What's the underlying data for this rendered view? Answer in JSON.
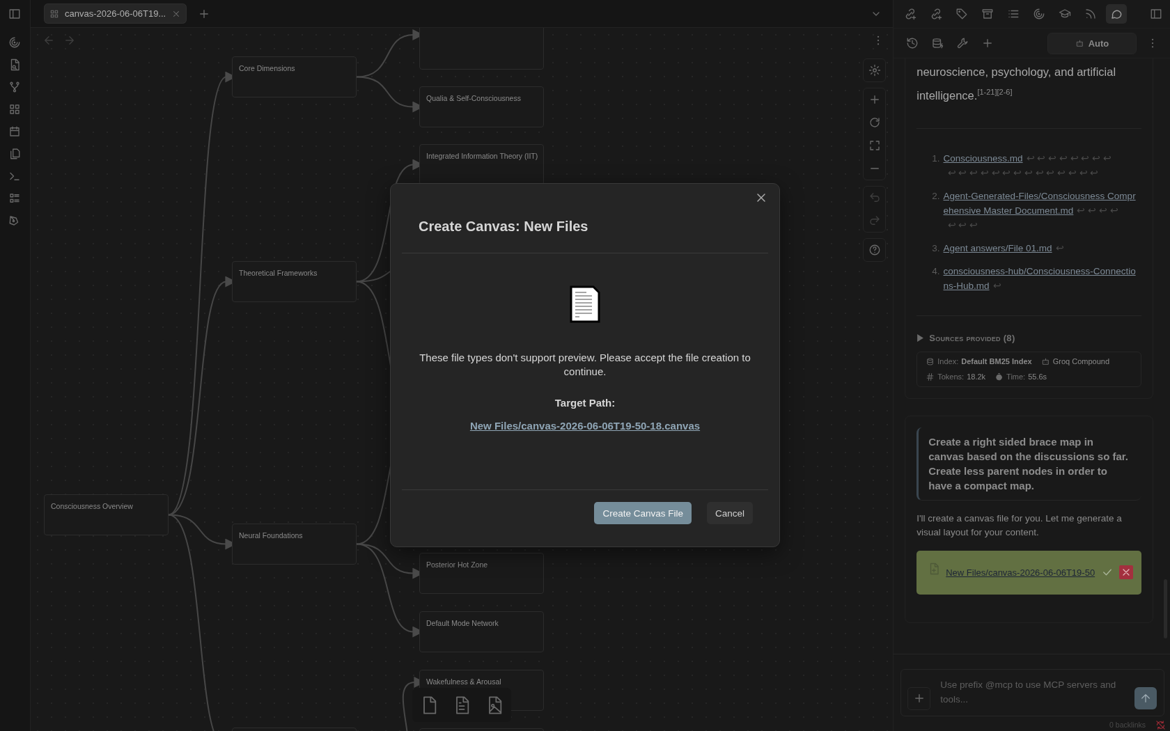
{
  "tab_bar": {
    "tabs": [
      {
        "title": "canvas-2026-06-06T19...",
        "selected": true
      }
    ]
  },
  "canvas": {
    "nodes": [
      {
        "label": "Core Dimensions"
      },
      {
        "label": "Qualia & Self-Consciousness"
      },
      {
        "label": "Integrated Information Theory (IIT)"
      },
      {
        "label": "Theoretical Frameworks"
      },
      {
        "label": "Consciousness Overview"
      },
      {
        "label": "Neural Foundations"
      },
      {
        "label": "Posterior Hot Zone"
      },
      {
        "label": "Default Mode Network"
      },
      {
        "label": "Wakefulness & Arousal"
      }
    ]
  },
  "dialog": {
    "title": "Create Canvas: New Files",
    "message": "These file types don't support preview. Please accept the file creation to continue.",
    "target_label": "Target Path:",
    "target_path": "New Files/canvas-2026-06-06T19-50-18.canvas",
    "buttons": [
      {
        "label": "Create Canvas File",
        "kind": "primary"
      },
      {
        "label": "Cancel",
        "kind": "secondary"
      }
    ]
  },
  "chat": {
    "mode_button": "Auto",
    "answer_tail": "neuroscience, psychology, and artificial intelligence.$^{[1-21][2-6]}$",
    "references": [
      {
        "number": "1.",
        "lines": [
          {
            "link": "Consciousness.md",
            "backrefs": "↩ ↩ ↩ ↩ ↩ ↩ ↩ ↩"
          },
          {
            "backrefs": "↩ ↩ ↩ ↩ ↩ ↩ ↩ ↩ ↩ ↩ ↩ ↩ ↩ ↩"
          }
        ]
      },
      {
        "number": "2.",
        "lines": [
          {
            "link": "Agent-Generated-Files/Consciousness Compr"
          },
          {
            "link": "ehensive Master Document.md",
            "backrefs": "↩ ↩ ↩ ↩"
          },
          {
            "backrefs": "↩ ↩ ↩"
          }
        ]
      },
      {
        "number": "3.",
        "lines": [
          {
            "link": "Agent answers/File 01.md",
            "backrefs": "↩"
          }
        ]
      },
      {
        "number": "4.",
        "lines": [
          {
            "link": "consciousness-hub/Consciousness-Connectio"
          },
          {
            "link": "ns-Hub.md",
            "backrefs": "↩"
          }
        ]
      }
    ],
    "sources": {
      "label": "Sources provided (8)",
      "expanded": false
    },
    "meta": {
      "index_label": "Index:",
      "index_value": "Default BM25 Index",
      "model": "Groq Compound",
      "tokens_label": "Tokens:",
      "tokens_value": "18.2k",
      "time_label": "Time:",
      "time_value": "55.6s"
    },
    "user_message": "Create a right sided brace map in canvas based on the discussions so far. Create less parent nodes in order to have a compact map.",
    "reply": "I'll create a canvas file for you. Let me generate a visual layout for your content.",
    "file_action": {
      "path": "New Files/canvas-2026-06-06T19-50"
    },
    "input": {
      "placeholder": "Use prefix @mcp to use MCP servers and tools..."
    }
  },
  "status_bar": {
    "backlinks": "0 backlinks"
  }
}
